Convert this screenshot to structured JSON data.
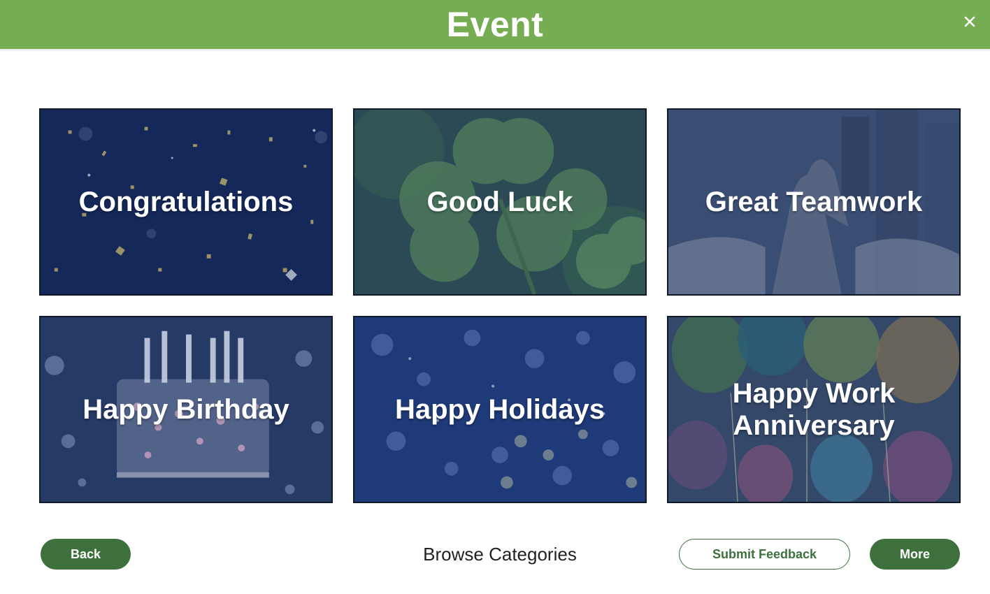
{
  "header": {
    "title": "Event",
    "background_color": "#76ad52",
    "close_icon": "close-icon"
  },
  "cards": [
    {
      "label": "Congratulations",
      "theme": "confetti",
      "overlay_color": "#132a55"
    },
    {
      "label": "Good Luck",
      "theme": "clover",
      "overlay_color": "#2f4f5a"
    },
    {
      "label": "Great Teamwork",
      "theme": "high-five",
      "overlay_color": "#34486e"
    },
    {
      "label": "Happy Birthday",
      "theme": "birthday-cake",
      "overlay_color": "#2a3d6a"
    },
    {
      "label": "Happy Holidays",
      "theme": "bokeh-lights",
      "overlay_color": "#233f78"
    },
    {
      "label": "Happy Work Anniversary",
      "theme": "balloons",
      "overlay_color": "#324a6c"
    }
  ],
  "footer": {
    "back_label": "Back",
    "browse_label": "Browse Categories",
    "feedback_label": "Submit Feedback",
    "more_label": "More",
    "button_color": "#3e703e"
  }
}
